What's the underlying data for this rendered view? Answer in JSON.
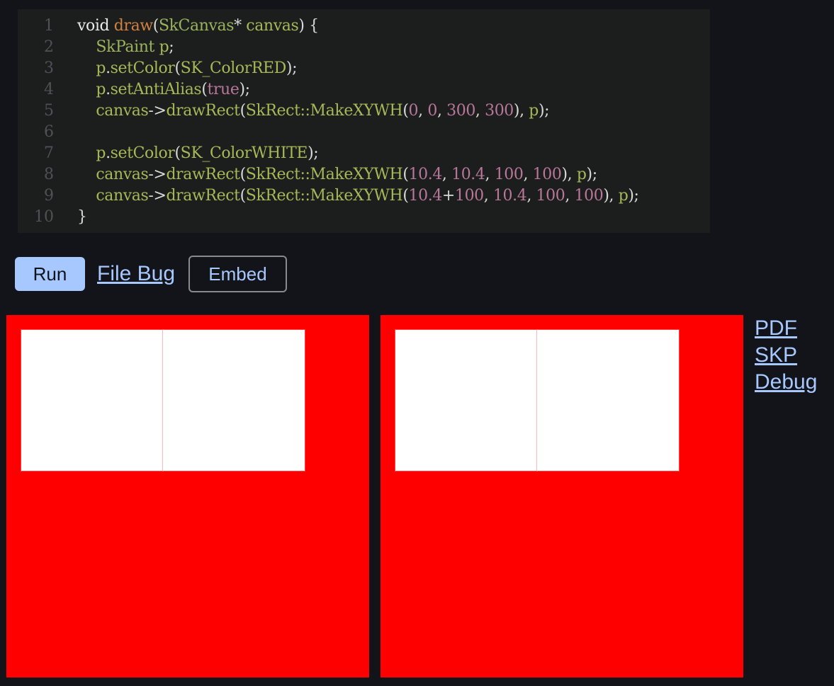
{
  "editor": {
    "lines": [
      {
        "num": "1",
        "tokens": [
          {
            "t": "void ",
            "c": "t-kw"
          },
          {
            "t": "draw",
            "c": "t-fn"
          },
          {
            "t": "(",
            "c": "t-p"
          },
          {
            "t": "SkCanvas",
            "c": "t-ty"
          },
          {
            "t": "* ",
            "c": "t-p"
          },
          {
            "t": "canvas",
            "c": "t-id"
          },
          {
            "t": ") {",
            "c": "t-p"
          }
        ]
      },
      {
        "num": "2",
        "tokens": [
          {
            "t": "    ",
            "c": "t-p"
          },
          {
            "t": "SkPaint",
            "c": "t-ty"
          },
          {
            "t": " ",
            "c": "t-p"
          },
          {
            "t": "p",
            "c": "t-id"
          },
          {
            "t": ";",
            "c": "t-p"
          }
        ]
      },
      {
        "num": "3",
        "tokens": [
          {
            "t": "    ",
            "c": "t-p"
          },
          {
            "t": "p",
            "c": "t-id"
          },
          {
            "t": ".",
            "c": "t-p"
          },
          {
            "t": "setColor",
            "c": "t-id"
          },
          {
            "t": "(",
            "c": "t-p"
          },
          {
            "t": "SK_ColorRED",
            "c": "t-id"
          },
          {
            "t": ");",
            "c": "t-p"
          }
        ]
      },
      {
        "num": "4",
        "tokens": [
          {
            "t": "    ",
            "c": "t-p"
          },
          {
            "t": "p",
            "c": "t-id"
          },
          {
            "t": ".",
            "c": "t-p"
          },
          {
            "t": "setAntiAlias",
            "c": "t-id"
          },
          {
            "t": "(",
            "c": "t-p"
          },
          {
            "t": "true",
            "c": "t-num"
          },
          {
            "t": ");",
            "c": "t-p"
          }
        ]
      },
      {
        "num": "5",
        "tokens": [
          {
            "t": "    ",
            "c": "t-p"
          },
          {
            "t": "canvas",
            "c": "t-id"
          },
          {
            "t": "->",
            "c": "t-p"
          },
          {
            "t": "drawRect",
            "c": "t-id"
          },
          {
            "t": "(",
            "c": "t-p"
          },
          {
            "t": "SkRect::MakeXYWH",
            "c": "t-id"
          },
          {
            "t": "(",
            "c": "t-p"
          },
          {
            "t": "0",
            "c": "t-num"
          },
          {
            "t": ", ",
            "c": "t-p"
          },
          {
            "t": "0",
            "c": "t-num"
          },
          {
            "t": ", ",
            "c": "t-p"
          },
          {
            "t": "300",
            "c": "t-num"
          },
          {
            "t": ", ",
            "c": "t-p"
          },
          {
            "t": "300",
            "c": "t-num"
          },
          {
            "t": "), ",
            "c": "t-p"
          },
          {
            "t": "p",
            "c": "t-id"
          },
          {
            "t": ");",
            "c": "t-p"
          }
        ]
      },
      {
        "num": "6",
        "tokens": []
      },
      {
        "num": "7",
        "tokens": [
          {
            "t": "    ",
            "c": "t-p"
          },
          {
            "t": "p",
            "c": "t-id"
          },
          {
            "t": ".",
            "c": "t-p"
          },
          {
            "t": "setColor",
            "c": "t-id"
          },
          {
            "t": "(",
            "c": "t-p"
          },
          {
            "t": "SK_ColorWHITE",
            "c": "t-id"
          },
          {
            "t": ");",
            "c": "t-p"
          }
        ]
      },
      {
        "num": "8",
        "tokens": [
          {
            "t": "    ",
            "c": "t-p"
          },
          {
            "t": "canvas",
            "c": "t-id"
          },
          {
            "t": "->",
            "c": "t-p"
          },
          {
            "t": "drawRect",
            "c": "t-id"
          },
          {
            "t": "(",
            "c": "t-p"
          },
          {
            "t": "SkRect::MakeXYWH",
            "c": "t-id"
          },
          {
            "t": "(",
            "c": "t-p"
          },
          {
            "t": "10.4",
            "c": "t-num"
          },
          {
            "t": ", ",
            "c": "t-p"
          },
          {
            "t": "10.4",
            "c": "t-num"
          },
          {
            "t": ", ",
            "c": "t-p"
          },
          {
            "t": "100",
            "c": "t-num"
          },
          {
            "t": ", ",
            "c": "t-p"
          },
          {
            "t": "100",
            "c": "t-num"
          },
          {
            "t": "), ",
            "c": "t-p"
          },
          {
            "t": "p",
            "c": "t-id"
          },
          {
            "t": ");",
            "c": "t-p"
          }
        ]
      },
      {
        "num": "9",
        "tokens": [
          {
            "t": "    ",
            "c": "t-p"
          },
          {
            "t": "canvas",
            "c": "t-id"
          },
          {
            "t": "->",
            "c": "t-p"
          },
          {
            "t": "drawRect",
            "c": "t-id"
          },
          {
            "t": "(",
            "c": "t-p"
          },
          {
            "t": "SkRect::MakeXYWH",
            "c": "t-id"
          },
          {
            "t": "(",
            "c": "t-p"
          },
          {
            "t": "10.4",
            "c": "t-num"
          },
          {
            "t": "+",
            "c": "t-p"
          },
          {
            "t": "100",
            "c": "t-num"
          },
          {
            "t": ", ",
            "c": "t-p"
          },
          {
            "t": "10.4",
            "c": "t-num"
          },
          {
            "t": ", ",
            "c": "t-p"
          },
          {
            "t": "100",
            "c": "t-num"
          },
          {
            "t": ", ",
            "c": "t-p"
          },
          {
            "t": "100",
            "c": "t-num"
          },
          {
            "t": "), ",
            "c": "t-p"
          },
          {
            "t": "p",
            "c": "t-id"
          },
          {
            "t": ");",
            "c": "t-p"
          }
        ]
      },
      {
        "num": "10",
        "tokens": [
          {
            "t": "}",
            "c": "t-p"
          }
        ]
      }
    ]
  },
  "toolbar": {
    "run_label": "Run",
    "file_bug_label": "File Bug",
    "embed_label": "Embed"
  },
  "side_links": {
    "pdf": "PDF",
    "skp": "SKP",
    "debug": "Debug"
  },
  "colors": {
    "accent": "#a6c8ff",
    "background": "#131419",
    "canvas_fill": "#ff0000",
    "rect_fill": "#ffffff"
  }
}
